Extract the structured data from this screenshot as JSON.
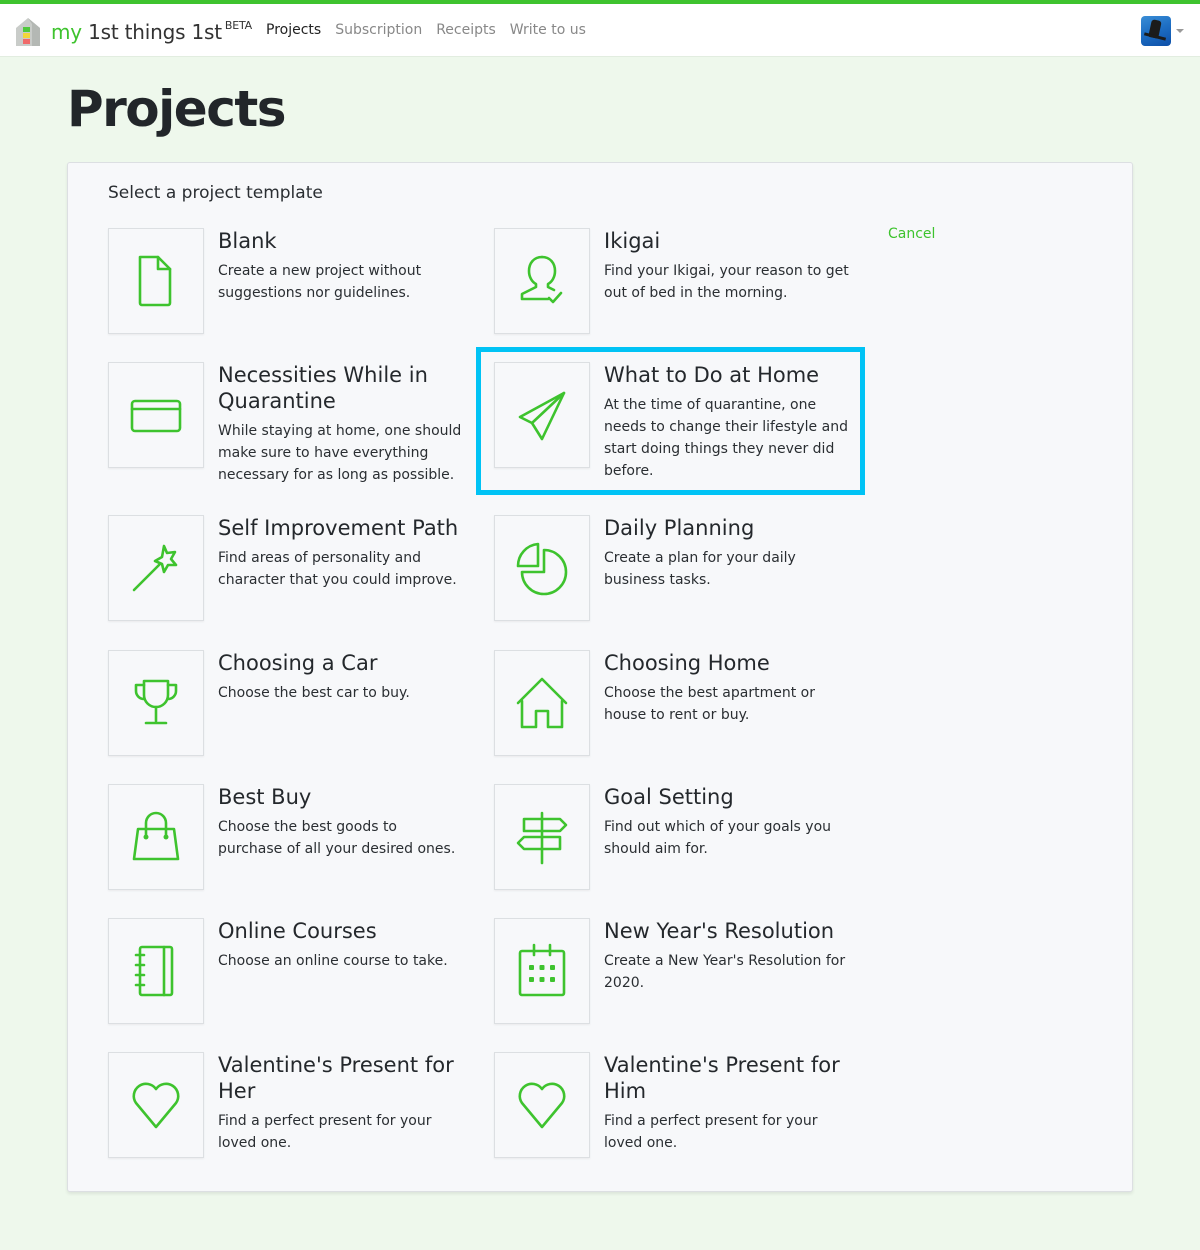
{
  "app": {
    "brand_prefix": "my",
    "brand_rest": " 1st things 1st",
    "brand_badge": "BETA"
  },
  "nav": {
    "items": [
      {
        "label": "Projects",
        "active": true
      },
      {
        "label": "Subscription",
        "active": false
      },
      {
        "label": "Receipts",
        "active": false
      },
      {
        "label": "Write to us",
        "active": false
      }
    ]
  },
  "user": {
    "avatar_icon": "user-avatar",
    "menu_icon": "caret-down-icon"
  },
  "page": {
    "title": "Projects"
  },
  "panel": {
    "heading": "Select a project template",
    "cancel_label": "Cancel"
  },
  "colors": {
    "accent": "#3ec32e",
    "highlight": "#00c3f5",
    "page_bg": "#eef8ec",
    "panel_bg": "#f7f8fa"
  },
  "templates": [
    {
      "title": "Blank",
      "description": "Create a new project without suggestions nor guidelines.",
      "icon": "document-icon"
    },
    {
      "title": "Ikigai",
      "description": "Find your Ikigai, your reason to get out of bed in the morning.",
      "icon": "user-check-icon"
    },
    {
      "title": "Necessities While in Quarantine",
      "description": "While staying at home, one should make sure to have everything necessary for as long as possible.",
      "icon": "credit-card-icon"
    },
    {
      "title": "What to Do at Home",
      "description": "At the time of quarantine, one needs to change their lifestyle and start doing things they never did before.",
      "icon": "paper-plane-icon",
      "highlighted": true
    },
    {
      "title": "Self Improvement Path",
      "description": "Find areas of personality and character that you could improve.",
      "icon": "magic-wand-icon"
    },
    {
      "title": "Daily Planning",
      "description": "Create a plan for your daily business tasks.",
      "icon": "pie-chart-icon"
    },
    {
      "title": "Choosing a Car",
      "description": "Choose the best car to buy.",
      "icon": "trophy-icon"
    },
    {
      "title": "Choosing Home",
      "description": "Choose the best apartment or house to rent or buy.",
      "icon": "house-icon"
    },
    {
      "title": "Best Buy",
      "description": "Choose the best goods to purchase of all your desired ones.",
      "icon": "shopping-bag-icon"
    },
    {
      "title": "Goal Setting",
      "description": "Find out which of your goals you should aim for.",
      "icon": "signpost-icon"
    },
    {
      "title": "Online Courses",
      "description": "Choose an online course to take.",
      "icon": "notebook-icon"
    },
    {
      "title": "New Year's Resolution",
      "description": "Create a New Year's Resolution for 2020.",
      "icon": "calendar-icon"
    },
    {
      "title": "Valentine's Present for Her",
      "description": "Find a perfect present for your loved one.",
      "icon": "heart-icon"
    },
    {
      "title": "Valentine's Present for Him",
      "description": "Find a perfect present for your loved one.",
      "icon": "heart-icon"
    }
  ]
}
